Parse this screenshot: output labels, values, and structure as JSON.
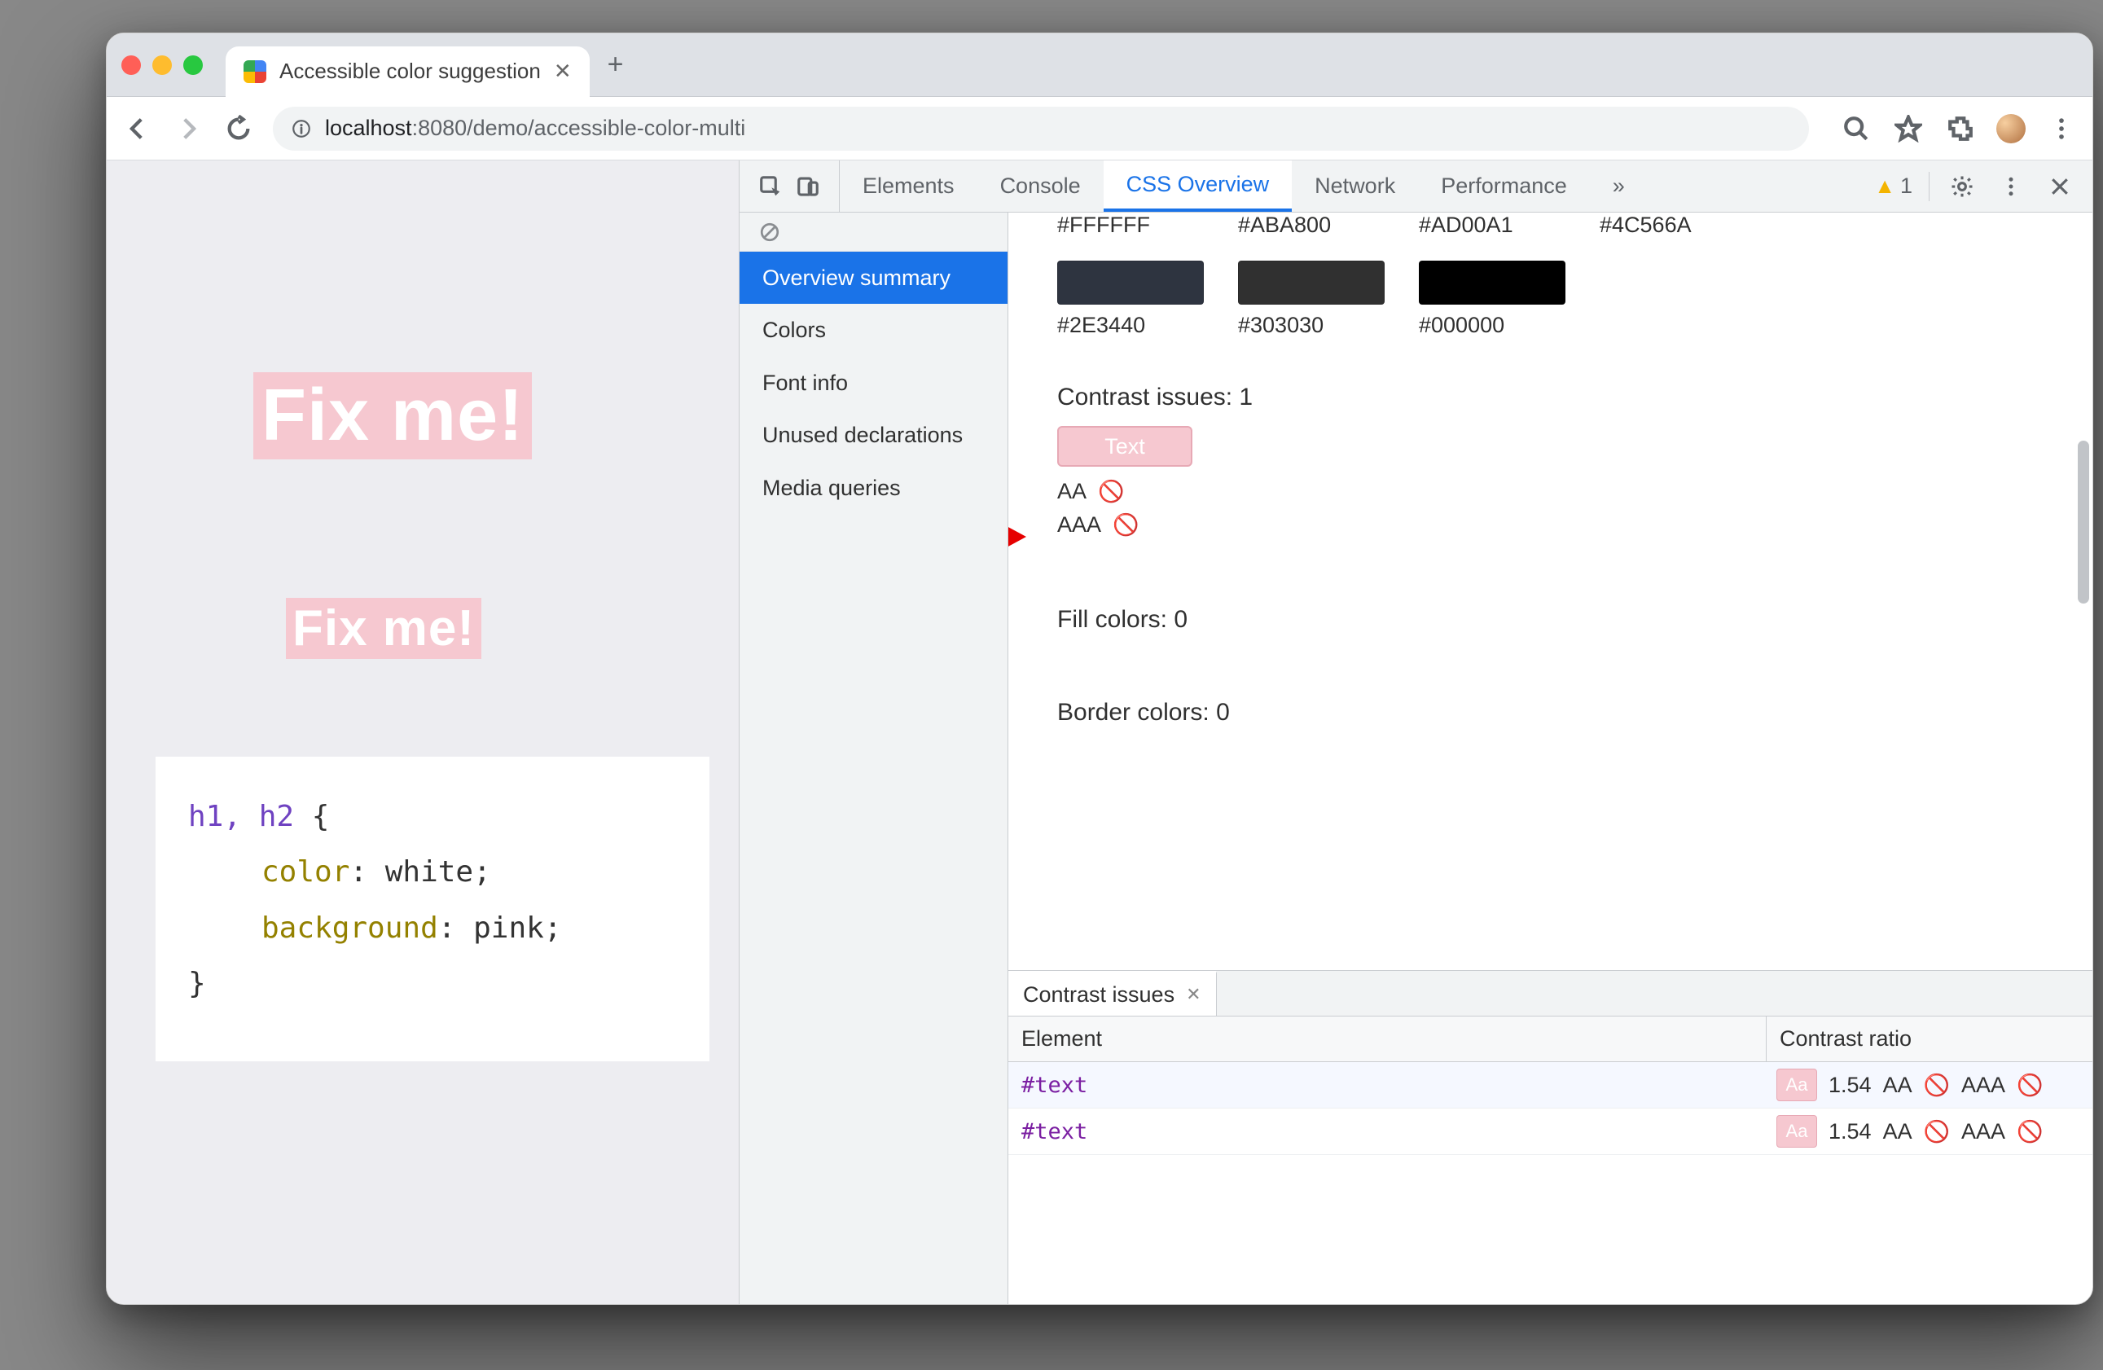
{
  "browser": {
    "tab_title": "Accessible color suggestion",
    "url_prefix": "localhost",
    "url_port_path": ":8080/demo/accessible-color-multi"
  },
  "page": {
    "heading1": "Fix me!",
    "heading2": "Fix me!",
    "code": {
      "selector": "h1, h2",
      "brace_open": " {",
      "prop1": "color",
      "val1": "white",
      "prop2": "background",
      "val2": "pink",
      "brace_close": "}"
    }
  },
  "devtools": {
    "tabs": [
      "Elements",
      "Console",
      "CSS Overview",
      "Network",
      "Performance"
    ],
    "more_glyph": "»",
    "warning_count": "1",
    "sidebar": {
      "items": [
        "Overview summary",
        "Colors",
        "Font info",
        "Unused declarations",
        "Media queries"
      ],
      "active_index": 0
    },
    "top_hex_row": [
      "#FFFFFF",
      "#ABA800",
      "#AD00A1",
      "#4C566A"
    ],
    "swatches": [
      {
        "hex": "#2E3440",
        "color": "#2E3440"
      },
      {
        "hex": "#303030",
        "color": "#303030"
      },
      {
        "hex": "#000000",
        "color": "#000000"
      }
    ],
    "contrast_issues_label": "Contrast issues: 1",
    "contrast_sample_text": "Text",
    "aa_label": "AA",
    "aaa_label": "AAA",
    "fill_colors_label": "Fill colors: 0",
    "border_colors_label": "Border colors: 0",
    "drawer": {
      "tab_label": "Contrast issues",
      "col_element": "Element",
      "col_ratio": "Contrast ratio",
      "rows": [
        {
          "el": "#text",
          "ratio": "1.54",
          "aa": "AA",
          "aaa": "AAA"
        },
        {
          "el": "#text",
          "ratio": "1.54",
          "aa": "AA",
          "aaa": "AAA"
        }
      ]
    }
  }
}
